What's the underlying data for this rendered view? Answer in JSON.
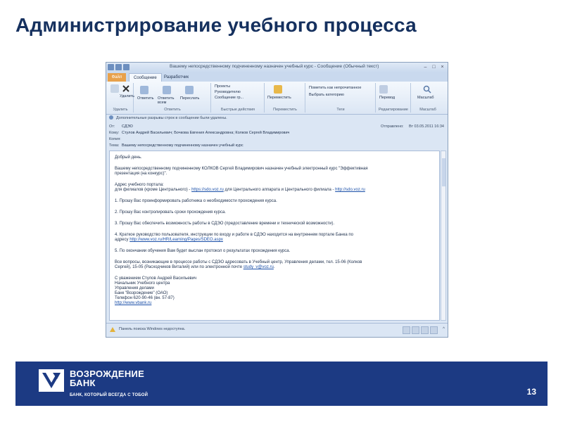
{
  "slide": {
    "title": "Администрирование учебного процесса",
    "page_number": "13"
  },
  "window": {
    "title": "Вашему непосредственному подчиненному назначен учебный курс - Сообщение (Обычный текст)",
    "controls": [
      "–",
      "□",
      "×"
    ]
  },
  "tabs": [
    {
      "label": "Файл",
      "active": false
    },
    {
      "label": "Сообщение",
      "active": true
    },
    {
      "label": "Разработчик",
      "active": false
    }
  ],
  "ribbon": {
    "groups": [
      {
        "label": "Удалить",
        "items": [
          "Удалить"
        ]
      },
      {
        "label": "Ответить",
        "items": [
          "Ответить",
          "Ответить всем",
          "Переслать"
        ]
      },
      {
        "label": "Быстрые действия",
        "items": [
          "Проекты",
          "Руководителю",
          "Сообщение гр..."
        ]
      },
      {
        "label": "Переместить",
        "items": [
          "Переместить"
        ]
      },
      {
        "label": "Теги",
        "items": [
          "Пометить как непрочитанное",
          "Выбрать категорию"
        ]
      },
      {
        "label": "Редактирование",
        "items": [
          "Перевод"
        ]
      },
      {
        "label": "Масштаб",
        "items": [
          "Масштаб"
        ]
      }
    ]
  },
  "message": {
    "info": "Дополнительные разрывы строк в сообщении были удалены.",
    "from_label": "От:",
    "from": "СДЭО",
    "to_label": "Кому:",
    "to": "Стулов Андрей Васильевич; Бочкова Евгения Александровна; Колков Сергей Владимирович",
    "cc_label": "Копия:",
    "cc": "",
    "subject_label": "Тема:",
    "subject": "Вашему непосредственному подчиненному назначен учебный курс",
    "sent_label": "Отправлено:",
    "sent": "Вт 03.05.2011 16:34"
  },
  "body": {
    "greeting": "Добрый день.",
    "p1a": "Вашему непосредственному подчиненному КОЛКОВ Сергей Владимирович назначен учебный электронный курс \"Эффективная",
    "p1b": "презентация (на конкурс)\".",
    "portal_label": "Адрес учебного портала:",
    "portal_a": "для филиалов (кроме Центрального) - ",
    "portal_link1": "https://sdo.voz.ru",
    "portal_b": " для Центрального аппарата и Центрального филиала - ",
    "portal_link2": "http://sdo.voz.ru",
    "i1": "1.        Прошу Вас проинформировать работника о необходимости прохождения курса.",
    "i2": "2.        Прошу Вас контролировать сроки прохождения курса.",
    "i3": "3.        Прошу Вас обеспечить возможность работы в СДЭО (предоставление времени и технической возможности).",
    "i4a": "4.        Краткое руководство пользователя, инструкции по входу и работе в СДЭО находится на внутреннем портале Банка по",
    "i4b_prefix": "адресу ",
    "i4b_link": "http://www.voz.ru/HR/Learning/Pages/SDEO.aspx",
    "i5": "5.        По окончании обучения Вам будет выслан протокол о результатах прохождения курса.",
    "q1": "Все вопросы, возникающие в процессе работы с СДЭО адресовать в Учебный центр, Управления делами, тел. 15-06 (Колков",
    "q2a": "Сергей), 15-05 (Расходчиков Виталий) или по электронной почте ",
    "q2_link": "study_v@voz.ru",
    "q2b": ".",
    "sig1": "С уважением Стулов Андрей Васильевич",
    "sig2": "Начальник Учебного центра",
    "sig3": "Управления делами",
    "sig4": "Банк \"Возрождение\" (ОАО)",
    "sig5": "Телефон 620-90-46 (вн. 57-87)",
    "sig_link": "http://www.vbank.ru"
  },
  "status": {
    "text": "Панель поиска Windows недоступна."
  },
  "footer": {
    "brand_line1": "ВОЗРОЖДЕНИЕ",
    "brand_line2": "БАНК",
    "slogan": "БАНК, КОТОРЫЙ ВСЕГДА С ТОБОЙ"
  },
  "colors": {
    "title": "#15305e",
    "footer_bg": "#1c3a83",
    "file_tab": "#e8a14b",
    "link": "#1a4fa8"
  }
}
